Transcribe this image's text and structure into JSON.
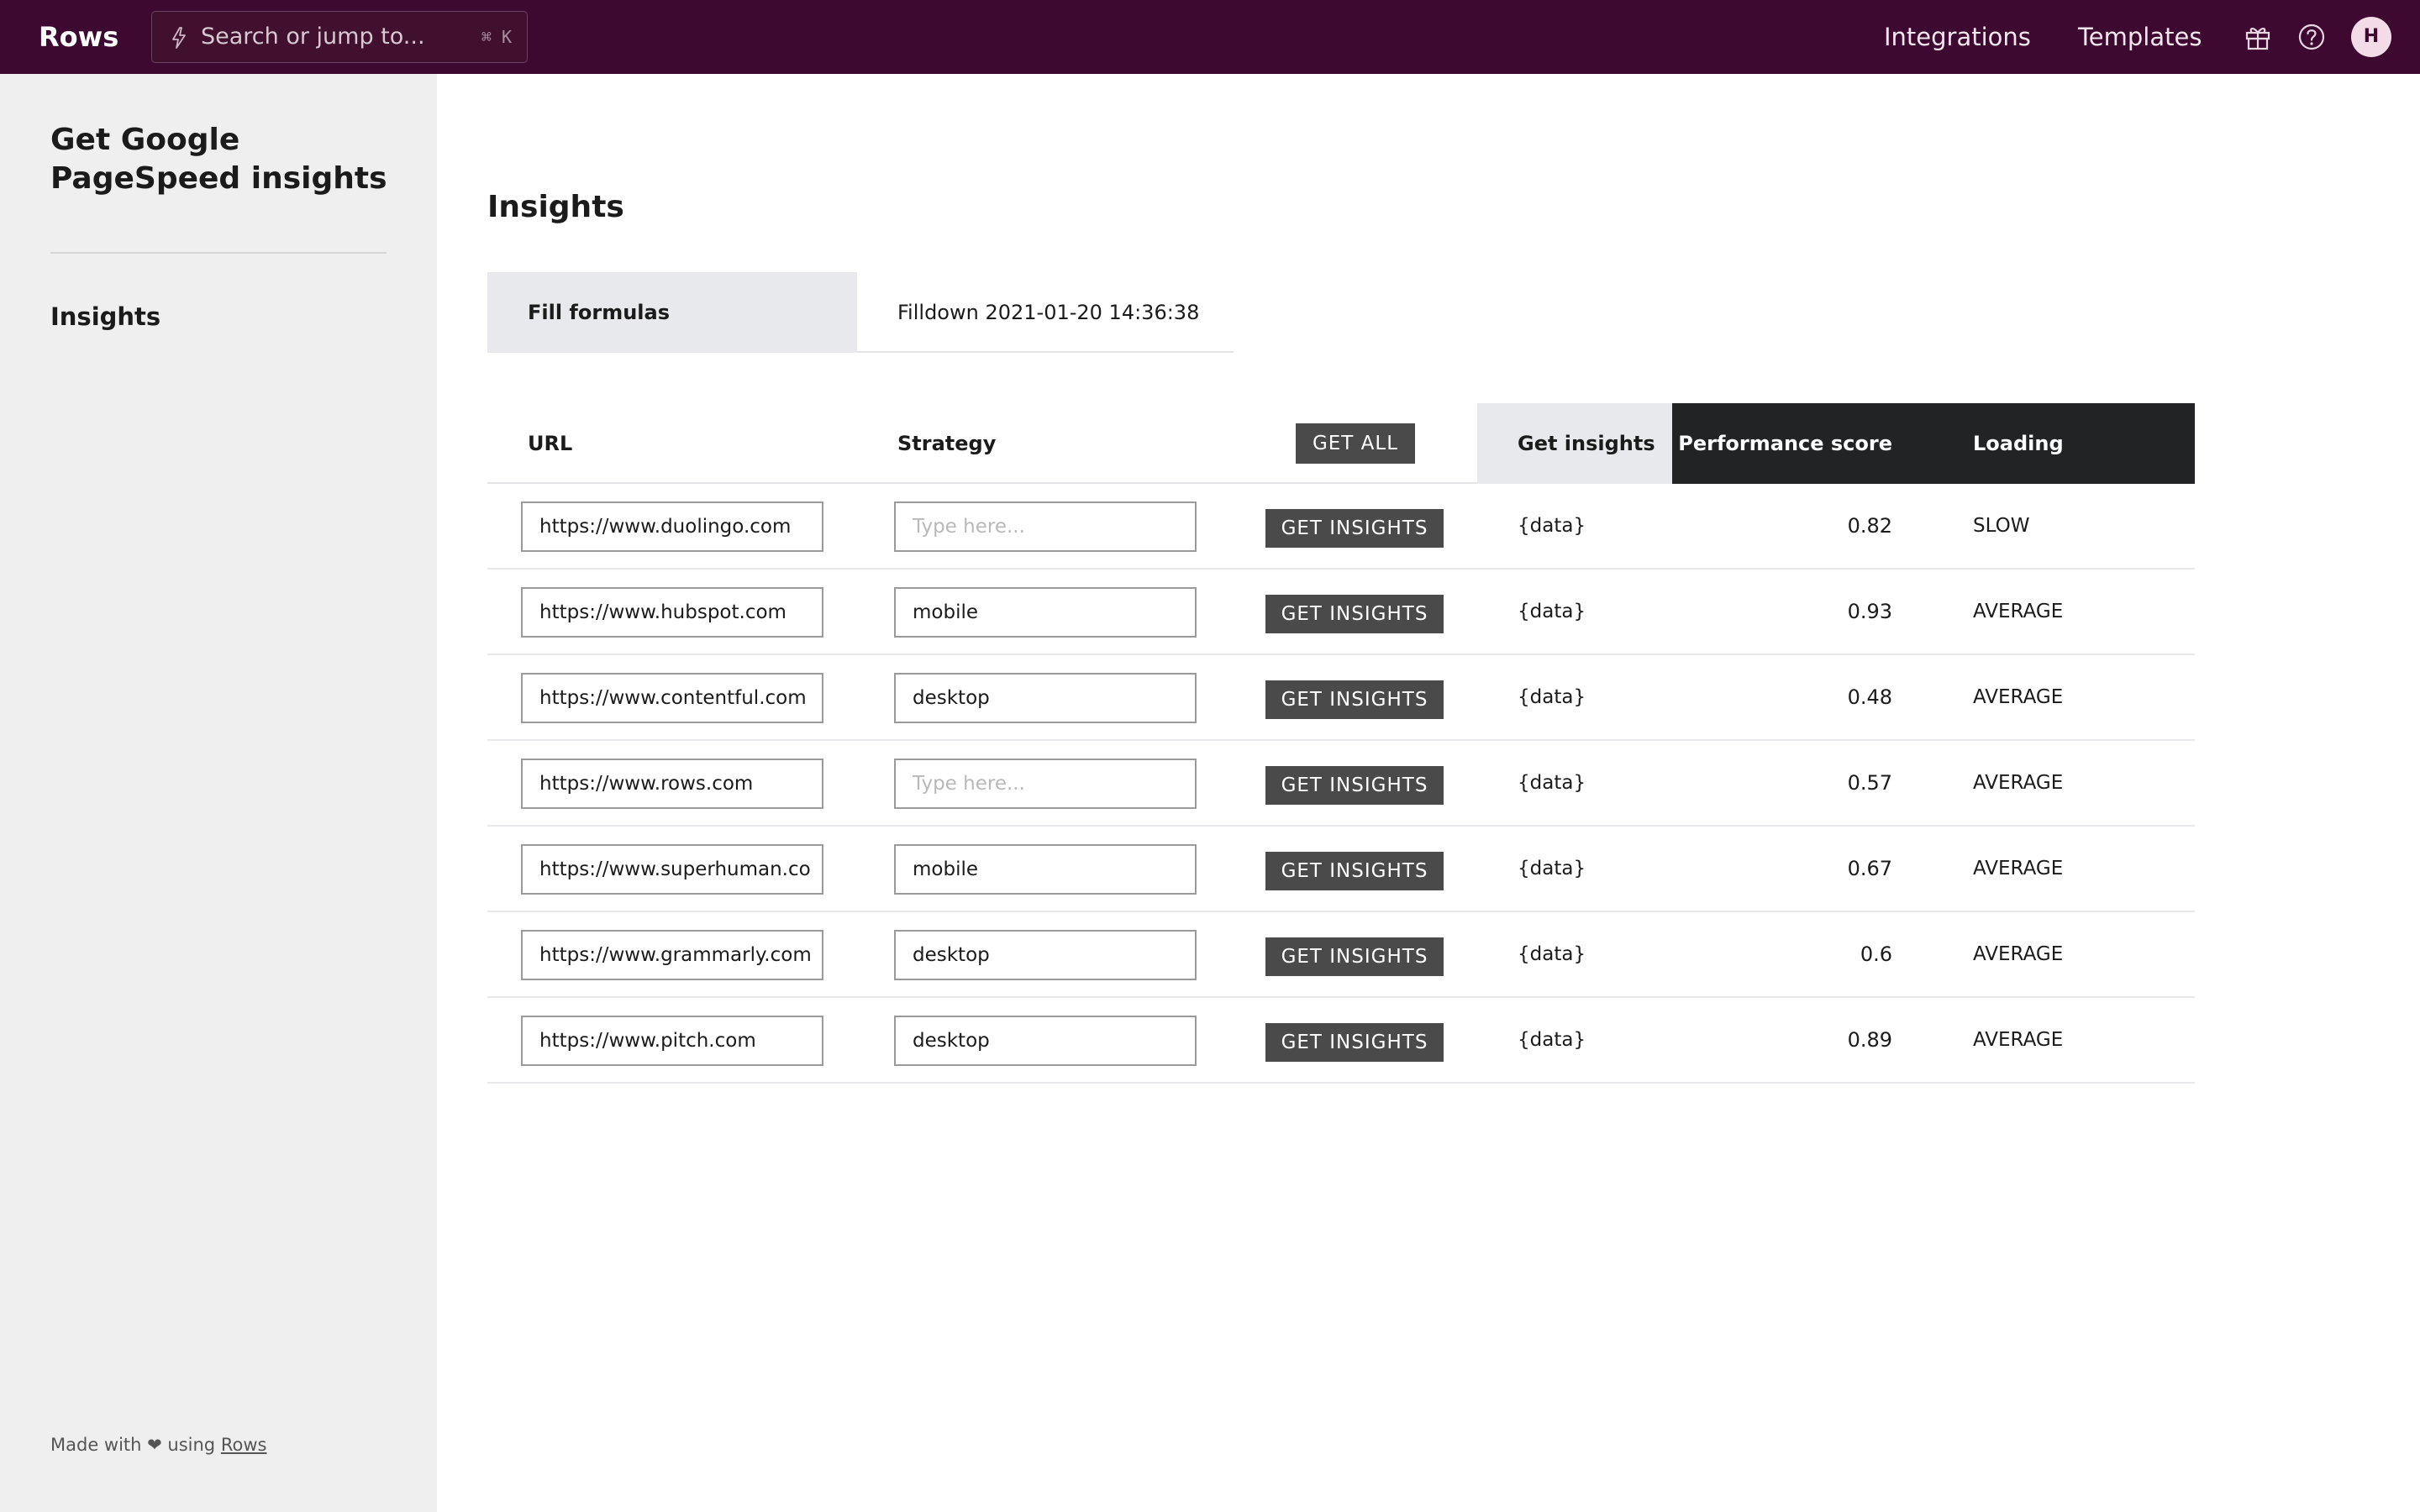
{
  "topbar": {
    "logo": "Rows",
    "search_placeholder": "Search or jump to...",
    "search_shortcut": "⌘ K",
    "nav": [
      {
        "label": "Integrations"
      },
      {
        "label": "Templates"
      }
    ],
    "avatar_initial": "H",
    "brand_color": "#3d0930"
  },
  "sidebar": {
    "title": "Get Google PageSpeed insights",
    "items": [
      {
        "label": "Insights"
      }
    ],
    "footer_prefix": "Made with ❤ using",
    "footer_link": "Rows"
  },
  "main": {
    "title": "Insights",
    "tabs": [
      {
        "label": "Fill formulas"
      },
      {
        "label": "Filldown 2021-01-20 14:36:38"
      }
    ],
    "table": {
      "headers": {
        "url": "URL",
        "strategy": "Strategy",
        "get_all": "GET ALL",
        "get_insights": "Get insights",
        "performance": "Performance score",
        "loading": "Loading experience"
      },
      "strategy_placeholder": "Type here...",
      "row_button_label": "GET INSIGHTS",
      "rows": [
        {
          "url": "https://www.duolingo.com",
          "strategy": "",
          "data": "{data}",
          "score": "0.82",
          "loading": "SLOW"
        },
        {
          "url": "https://www.hubspot.com",
          "strategy": "mobile",
          "data": "{data}",
          "score": "0.93",
          "loading": "AVERAGE"
        },
        {
          "url": "https://www.contentful.com",
          "strategy": "desktop",
          "data": "{data}",
          "score": "0.48",
          "loading": "AVERAGE"
        },
        {
          "url": "https://www.rows.com",
          "strategy": "",
          "data": "{data}",
          "score": "0.57",
          "loading": "AVERAGE"
        },
        {
          "url": "https://www.superhuman.co",
          "strategy": "mobile",
          "data": "{data}",
          "score": "0.67",
          "loading": "AVERAGE"
        },
        {
          "url": "https://www.grammarly.com",
          "strategy": "desktop",
          "data": "{data}",
          "score": "0.6",
          "loading": "AVERAGE"
        },
        {
          "url": "https://www.pitch.com",
          "strategy": "desktop",
          "data": "{data}",
          "score": "0.89",
          "loading": "AVERAGE"
        }
      ]
    }
  }
}
